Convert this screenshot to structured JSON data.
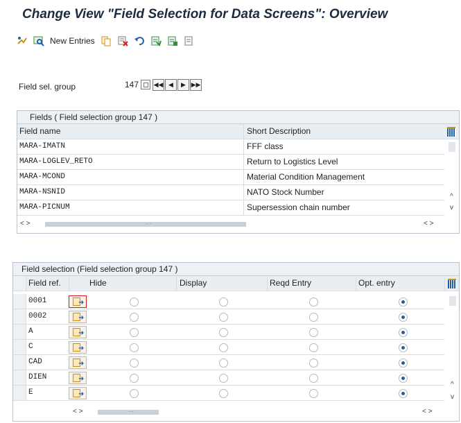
{
  "window": {
    "title": "Change View \"Field Selection for Data Screens\": Overview"
  },
  "toolbar": {
    "items": [
      {
        "name": "display-change-icon",
        "label": ""
      },
      {
        "name": "find-icon",
        "label": ""
      },
      {
        "name": "new-entries-button",
        "label": "New Entries"
      },
      {
        "name": "copy-icon",
        "label": ""
      },
      {
        "name": "delete-icon",
        "label": ""
      },
      {
        "name": "undo-icon",
        "label": ""
      },
      {
        "name": "select-all-icon",
        "label": ""
      },
      {
        "name": "select-block-icon",
        "label": ""
      },
      {
        "name": "deselect-all-icon",
        "label": ""
      }
    ],
    "colors": {
      "accent": "#1f5fa8",
      "warning": "#d28b12"
    }
  },
  "field_sel_group": {
    "label": "Field sel. group",
    "value": "147"
  },
  "fields_panel": {
    "title": "Fields ( Field selection group 147 )",
    "columns": [
      "Field name",
      "Short Description"
    ],
    "rows": [
      [
        "MARA-IMATN",
        "FFF class"
      ],
      [
        "MARA-LOGLEV_RETO",
        "Return to Logistics Level"
      ],
      [
        "MARA-MCOND",
        "Material Condition Management"
      ],
      [
        "MARA-NSNID",
        "NATO Stock Number"
      ],
      [
        "MARA-PICNUM",
        "Supersession chain number"
      ]
    ]
  },
  "selection_panel": {
    "title": "Field selection (Field selection group 147 )",
    "columns": [
      "Field ref.",
      "Hide",
      "Display",
      "Reqd Entry",
      "Opt. entry"
    ],
    "rows": [
      {
        "ref": "0001",
        "choice": "Opt. entry",
        "active": true
      },
      {
        "ref": "0002",
        "choice": "Opt. entry",
        "active": false
      },
      {
        "ref": "A",
        "choice": "Opt. entry",
        "active": false
      },
      {
        "ref": "C",
        "choice": "Opt. entry",
        "active": false
      },
      {
        "ref": "CAD",
        "choice": "Opt. entry",
        "active": false
      },
      {
        "ref": "DIEN",
        "choice": "Opt. entry",
        "active": false
      },
      {
        "ref": "E",
        "choice": "Opt. entry",
        "active": false
      }
    ]
  },
  "scroll_symbols": {
    "left_right": "< >",
    "up": "^",
    "down": "v"
  }
}
